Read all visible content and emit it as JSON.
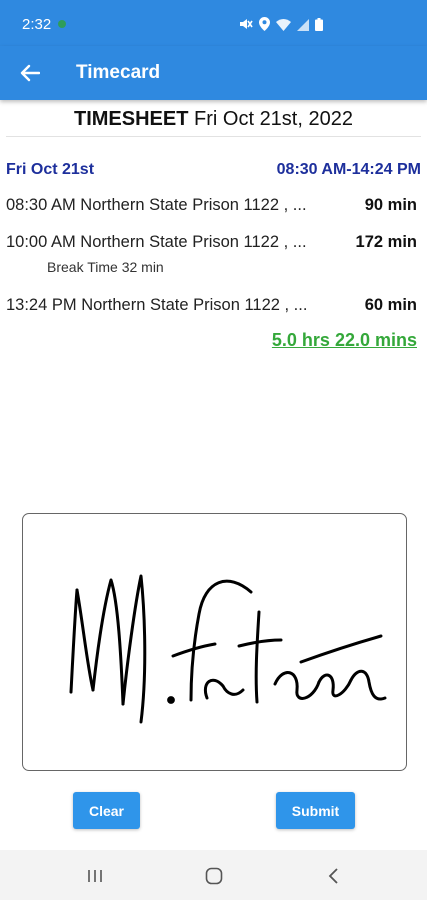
{
  "status_bar": {
    "time": "2:32",
    "icons": [
      "mute-icon",
      "location-icon",
      "wifi-icon",
      "signal-icon",
      "battery-icon"
    ]
  },
  "app_bar": {
    "back_icon": "arrow-left-icon",
    "title": "Timecard"
  },
  "timesheet": {
    "title_bold": "TIMESHEET",
    "title_date": "Fri Oct 21st, 2022",
    "day_label": "Fri Oct 21st",
    "time_range": "08:30 AM-14:24 PM",
    "entries": [
      {
        "description": "08:30 AM Northern State Prison 1122 , ...",
        "minutes": "90 min"
      },
      {
        "description": "10:00 AM Northern State Prison 1122 , ...",
        "minutes": "172 min",
        "note": "Break Time 32 min"
      },
      {
        "description": "13:24 PM Northern State Prison 1122 , ...",
        "minutes": "60 min"
      }
    ],
    "total": "5.0 hrs 22.0 mins"
  },
  "signature": {
    "signed": true
  },
  "actions": {
    "clear_label": "Clear",
    "submit_label": "Submit"
  },
  "nav_bar": {
    "items": [
      "recent-apps-icon",
      "home-icon",
      "back-icon"
    ]
  },
  "colors": {
    "primary": "#2f89e0",
    "button": "#2f95ea",
    "day_header": "#1d2f9c",
    "total": "#34a83a"
  }
}
